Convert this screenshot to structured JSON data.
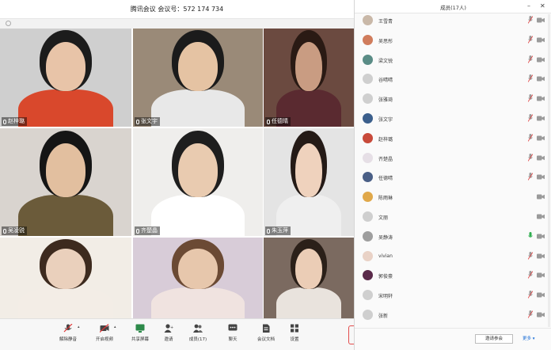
{
  "meeting": {
    "title": "腾讯会议 会议号：572 174 734",
    "tiles": [
      {
        "name": "赵梓璐",
        "bg": "#cfcfcf",
        "skin": "#e8c4a8",
        "shirt": "#d9482c",
        "hair": "#1c1c1c"
      },
      {
        "name": "张文宇",
        "bg": "#9a8a78",
        "skin": "#e5c3a3",
        "shirt": "#e8e8e8",
        "hair": "#1b1b1b"
      },
      {
        "name": "任德晴",
        "bg": "#6b4a40",
        "skin": "#c99c82",
        "shirt": "#5a2a30",
        "hair": "#2a1a14"
      },
      {
        "name": "吴凌锐",
        "bg": "#d9d4cf",
        "skin": "#e2bf9f",
        "shirt": "#6b5b3a",
        "hair": "#151515"
      },
      {
        "name": "齐楚晶",
        "bg": "#efeeec",
        "skin": "#e9cbb0",
        "shirt": "#ffffff",
        "hair": "#1e1e1e"
      },
      {
        "name": "朱玉萍",
        "bg": "#e4e4e4",
        "skin": "#efd2bd",
        "shirt": "#efefef",
        "hair": "#241a16"
      },
      {
        "name": "",
        "bg": "#f2ede6",
        "skin": "#ead0bc",
        "shirt": "#f3ede6",
        "hair": "#3d2a1e"
      },
      {
        "name": "",
        "bg": "#d8ccd8",
        "skin": "#e7c7ac",
        "shirt": "#f0e3e0",
        "hair": "#6b4a34"
      },
      {
        "name": "",
        "bg": "#7b6a60",
        "skin": "#ebcdb6",
        "shirt": "#e9e3dd",
        "hair": "#2b2019"
      }
    ]
  },
  "toolbar": {
    "buttons": [
      {
        "label": "解除静音",
        "icon": "mic-muted-icon"
      },
      {
        "label": "开启视频",
        "icon": "camera-off-icon"
      },
      {
        "label": "共享屏幕",
        "icon": "share-screen-icon"
      },
      {
        "label": "邀请",
        "icon": "invite-icon"
      },
      {
        "label": "成员(17)",
        "icon": "members-icon"
      },
      {
        "label": "聊天",
        "icon": "chat-icon"
      },
      {
        "label": "会议文档",
        "icon": "document-icon"
      },
      {
        "label": "设置",
        "icon": "apps-icon"
      }
    ]
  },
  "panel": {
    "title": "成员(17人)",
    "invite_label": "邀请参会",
    "more_label": "更多",
    "accent": "#1d6fd6",
    "members": [
      {
        "name": "王雪青",
        "avatar_color": "#c9b8a8",
        "mic": "muted",
        "cam": "off"
      },
      {
        "name": "吴思彤",
        "avatar_color": "#d07c5c",
        "mic": "muted",
        "cam": "off"
      },
      {
        "name": "梁文锐",
        "avatar_color": "#5a8c86",
        "mic": "muted",
        "cam": "off"
      },
      {
        "name": "谷晴晴",
        "avatar_color": "#cfcfcf",
        "mic": "muted",
        "cam": "off"
      },
      {
        "name": "张雅琦",
        "avatar_color": "#cfcfcf",
        "mic": "muted",
        "cam": "off"
      },
      {
        "name": "张文宇",
        "avatar_color": "#3b5f8c",
        "mic": "muted",
        "cam": "off"
      },
      {
        "name": "赵梓璐",
        "avatar_color": "#c84a3a",
        "mic": "muted",
        "cam": "off"
      },
      {
        "name": "齐楚晶",
        "avatar_color": "#e6dfe6",
        "mic": "muted",
        "cam": "off"
      },
      {
        "name": "任德晴",
        "avatar_color": "#4a5f86",
        "mic": "muted",
        "cam": "off"
      },
      {
        "name": "陈雨琳",
        "avatar_color": "#e0a84a",
        "mic": "none",
        "cam": "off"
      },
      {
        "name": "文丽",
        "avatar_color": "#cfcfcf",
        "mic": "none",
        "cam": "off"
      },
      {
        "name": "吴静涛",
        "avatar_color": "#9e9e9e",
        "mic": "active",
        "cam": "off"
      },
      {
        "name": "vivian",
        "avatar_color": "#e9d2c6",
        "mic": "muted",
        "cam": "off"
      },
      {
        "name": "郭俊豪",
        "avatar_color": "#5a2a4a",
        "mic": "muted",
        "cam": "off"
      },
      {
        "name": "宋明轩",
        "avatar_color": "#cfcfcf",
        "mic": "muted",
        "cam": "off"
      },
      {
        "name": "张新",
        "avatar_color": "#cfcfcf",
        "mic": "muted",
        "cam": "off"
      }
    ]
  }
}
